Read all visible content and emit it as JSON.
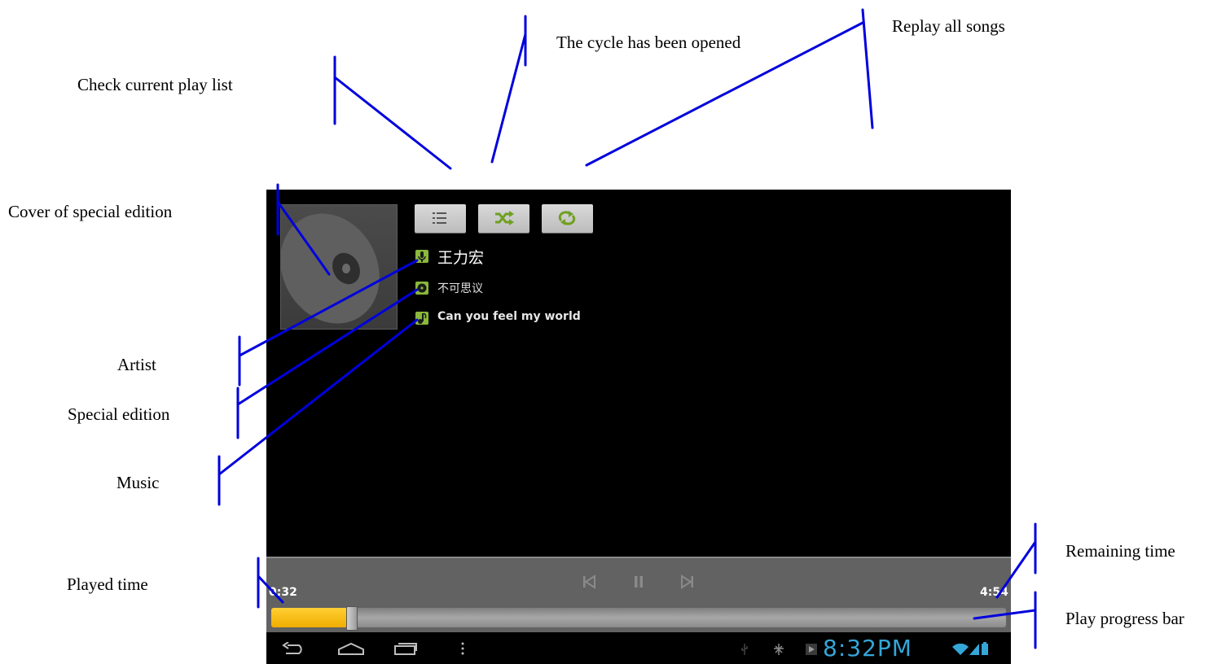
{
  "annotations": {
    "cycle_opened": "The cycle has been opened",
    "replay_all": "Replay all songs",
    "check_playlist": "Check current play list",
    "cover": "Cover of special edition",
    "artist": "Artist",
    "special_edition": "Special edition",
    "music": "Music",
    "played_time": "Played time",
    "remaining_time": "Remaining time",
    "progress_bar": "Play progress bar"
  },
  "player": {
    "artist": "王力宏",
    "album": "不可思议",
    "track": "Can you feel my world",
    "played_time": "0:32",
    "remaining_time": "4:54",
    "progress": 0.11,
    "buttons": [
      "playlist-icon",
      "shuffle-icon",
      "repeat-icon"
    ]
  },
  "status_bar": {
    "clock": "8:32PM"
  },
  "colors": {
    "leader_line": "#0000dd",
    "icon_green": "#8ab83a",
    "progress_fill": "#f8b800",
    "clock": "#35a6d8"
  }
}
